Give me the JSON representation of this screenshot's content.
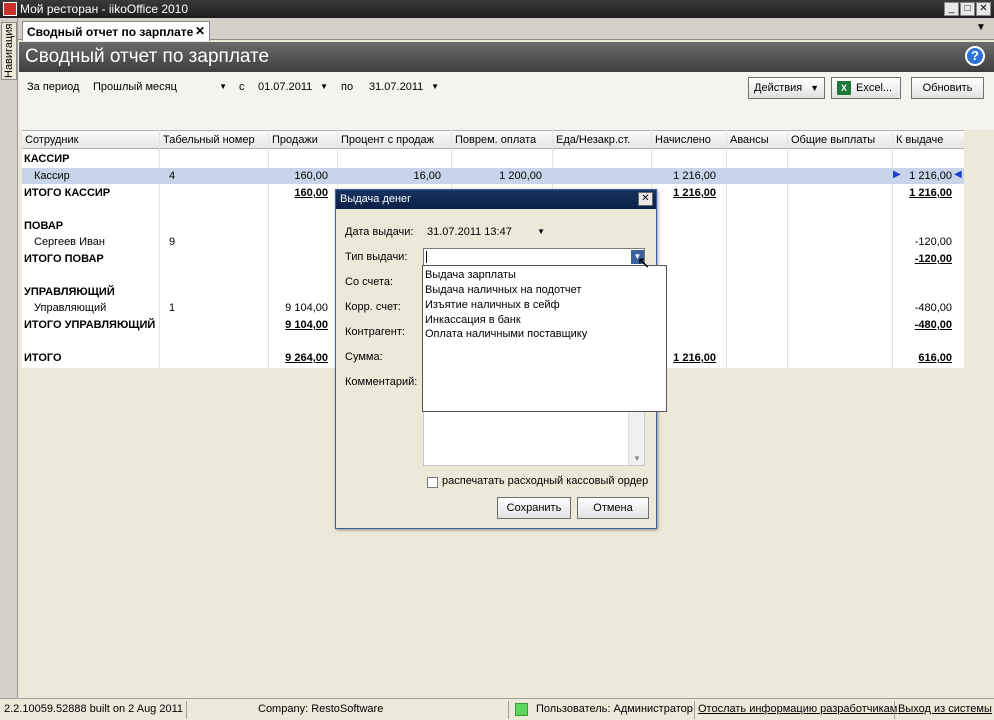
{
  "window": {
    "title": "Мой ресторан - iikoOffice 2010"
  },
  "nav": {
    "label": "Навигация"
  },
  "tab": {
    "label": "Сводный отчет по зарплате",
    "close": "✕"
  },
  "page": {
    "title": "Сводный отчет по зарплате"
  },
  "filters": {
    "period_label": "За период",
    "period_value": "Прошлый месяц",
    "from_label": "с",
    "from_value": "01.07.2011",
    "to_label": "по",
    "to_value": "31.07.2011"
  },
  "toolbar": {
    "actions": "Действия",
    "excel": "Excel...",
    "refresh": "Обновить"
  },
  "table": {
    "columns": [
      "Сотрудник",
      "Табельный номер",
      "Продажи",
      "Процент с продаж",
      "Поврем. оплата",
      "Еда/Незакр.ст.",
      "Начислено",
      "Авансы",
      "Общие выплаты",
      "К выдаче"
    ],
    "rows": [
      {
        "name": "КАССИР",
        "kind": "group"
      },
      {
        "name": "Кассир",
        "kind": "item",
        "tab": "4",
        "sales": "160,00",
        "percent": "16,00",
        "time_pay": "1 200,00",
        "accrued": "1 216,00",
        "payout": "1 216,00"
      },
      {
        "name": "ИТОГО КАССИР",
        "kind": "total",
        "sales": "160,00",
        "accrued": "1 216,00",
        "payout": "1 216,00"
      },
      {
        "name": "ПОВАР",
        "kind": "group"
      },
      {
        "name": "Сергеев Иван",
        "kind": "item",
        "tab": "9",
        "payout": "-120,00"
      },
      {
        "name": "ИТОГО ПОВАР",
        "kind": "total",
        "payout": "-120,00"
      },
      {
        "name": "УПРАВЛЯЮЩИЙ",
        "kind": "group"
      },
      {
        "name": "Управляющий",
        "kind": "item",
        "tab": "1",
        "sales": "9 104,00",
        "payout": "-480,00"
      },
      {
        "name": "ИТОГО УПРАВЛЯЮЩИЙ",
        "kind": "total",
        "sales": "9 104,00",
        "payout": "-480,00"
      },
      {
        "name": "ИТОГО",
        "kind": "grand",
        "sales": "9 264,00",
        "accrued": "1 216,00",
        "payout": "616,00"
      }
    ]
  },
  "dialog": {
    "title": "Выдача денег",
    "date_label": "Дата выдачи:",
    "date_value": "31.07.2011 13:47",
    "type_label": "Тип выдачи:",
    "type_value": "",
    "from_account_label": "Со счета:",
    "corr_account_label": "Корр. счет:",
    "counterparty_label": "Контрагент:",
    "amount_label": "Сумма:",
    "comment_label": "Комментарий:",
    "print_label": "распечатать расходный кассовый ордер",
    "save": "Сохранить",
    "cancel": "Отмена",
    "type_options": [
      "Выдача зарплаты",
      "Выдача наличных на подотчет",
      "Изъятие наличных в сейф",
      "Инкассация в банк",
      "Оплата наличными поставщику"
    ]
  },
  "status": {
    "build": "2.2.10059.52888 built on 2 Aug 2011",
    "company": "Company: RestoSoftware",
    "user": "Пользователь: Администратор",
    "dev_info": "Отослать информацию разработчикам",
    "logout": "Выход из системы"
  },
  "colors": {
    "selection": "#c8d4ea",
    "header": "#4a4a4a",
    "accent": "#0a2148",
    "led": "#5fd65f"
  }
}
